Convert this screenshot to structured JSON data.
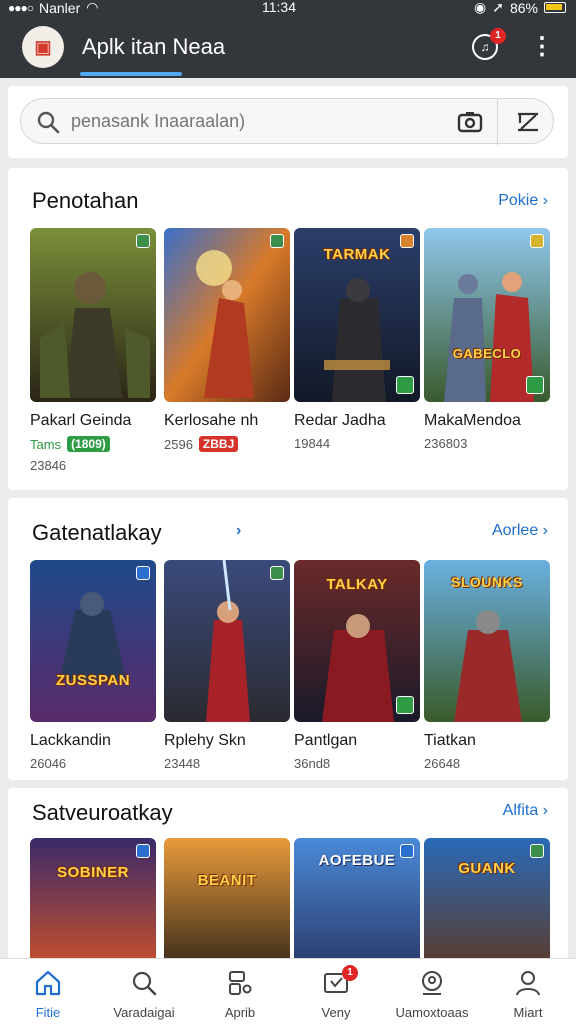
{
  "status": {
    "carrier": "Nanler",
    "time": "11:34",
    "battery": "86%"
  },
  "header": {
    "title": "Aplk itan Neaa",
    "notification_count": "1"
  },
  "search": {
    "placeholder": "penasank Inaaraalan)"
  },
  "sections": [
    {
      "title": "Penotahan",
      "more": "Pokie",
      "items": [
        {
          "name": "Pakarl Geinda",
          "sub_text": "Tams",
          "sub_chip": "(1809)",
          "count": "23846",
          "chip_color": "#2e9c45"
        },
        {
          "name": "Kerlosahe nh",
          "sub_text": "2596",
          "sub_chip": "ZBBJ",
          "count": "",
          "chip_color": "#d6332b"
        },
        {
          "name": "Redar Jadha",
          "sub_text": "",
          "sub_chip": "",
          "count": "19844",
          "chip_color": ""
        },
        {
          "name": "MakaMendoa",
          "sub_text": "",
          "sub_chip": "",
          "count": "236803",
          "chip_color": ""
        }
      ],
      "logos": [
        "",
        "",
        "TARMAK",
        "GABECLO"
      ]
    },
    {
      "title": "Gatenatlakay",
      "more": "Aorlee",
      "items": [
        {
          "name": "Lackkandin",
          "count": "26046"
        },
        {
          "name": "Rplehy Skn",
          "count": "23448"
        },
        {
          "name": "Pantlgan",
          "count": "36nd8"
        },
        {
          "name": "Tiatkan",
          "count": "26648"
        }
      ],
      "logos": [
        "ZUSSPAN",
        "",
        "TALKAY",
        "SLOUNKS"
      ]
    },
    {
      "title": "Satveuroatkay",
      "more": "Alfita",
      "items": [],
      "logos": [
        "SOBINER",
        "BEANIT",
        "AOFEBUE",
        "GUANK"
      ]
    }
  ],
  "nav": [
    {
      "label": "Fitie",
      "icon": "home-icon",
      "active": true
    },
    {
      "label": "Varadaigai",
      "icon": "search-icon"
    },
    {
      "label": "Aprib",
      "icon": "apps-icon"
    },
    {
      "label": "Veny",
      "icon": "inbox-icon",
      "badge": "1"
    },
    {
      "label": "Uamoxtoaas",
      "icon": "updates-icon"
    },
    {
      "label": "Miart",
      "icon": "profile-icon"
    }
  ],
  "colors": {
    "accent": "#1f6fd1",
    "header_bg": "#33363b",
    "badge": "#e02525"
  }
}
